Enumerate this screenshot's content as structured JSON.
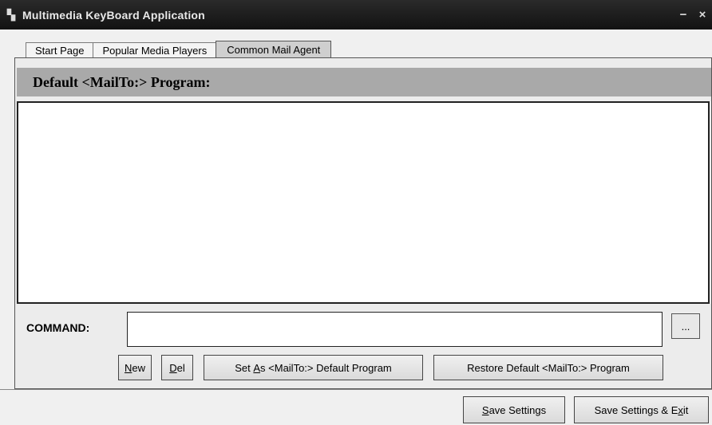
{
  "window": {
    "title": "Multimedia KeyBoard Application",
    "icon": "app-icon",
    "minimize": "−",
    "close": "×"
  },
  "tabs": [
    {
      "label": "Start Page",
      "active": false
    },
    {
      "label": "Popular Media Players",
      "active": false
    },
    {
      "label": "Common Mail Agent",
      "active": true
    }
  ],
  "panel": {
    "header": "Default <MailTo:> Program:",
    "list_items": []
  },
  "command": {
    "label": "COMMAND:",
    "value": "",
    "browse_label": "..."
  },
  "actions": {
    "new": {
      "mnemonic": "N",
      "rest": "ew"
    },
    "del": {
      "mnemonic": "D",
      "rest": "el"
    },
    "set_default": {
      "before": "Set ",
      "mnemonic": "A",
      "rest": "s <MailTo:> Default Program"
    },
    "restore_default": "Restore Default <MailTo:> Program"
  },
  "footer": {
    "save": {
      "mnemonic": "S",
      "rest": "ave Settings"
    },
    "save_exit": {
      "before": "Save Settings & E",
      "mnemonic": "x",
      "rest": "it"
    }
  },
  "colors": {
    "titlebar": "#1a1a1a",
    "header_band": "#a9a9a9",
    "background": "#f0f0f0"
  }
}
